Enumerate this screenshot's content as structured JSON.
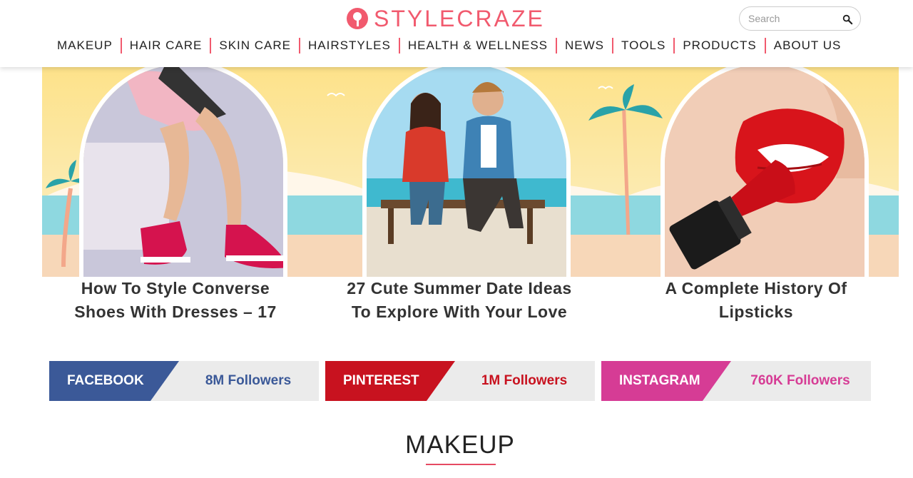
{
  "brand": {
    "name": "STYLECRAZE",
    "color": "#f15a6e"
  },
  "search": {
    "placeholder": "Search",
    "icon": "search-icon"
  },
  "nav": {
    "items": [
      {
        "label": "MAKEUP"
      },
      {
        "label": "HAIR CARE"
      },
      {
        "label": "SKIN CARE"
      },
      {
        "label": "HAIRSTYLES"
      },
      {
        "label": "HEALTH & WELLNESS"
      },
      {
        "label": "NEWS"
      },
      {
        "label": "TOOLS"
      },
      {
        "label": "PRODUCTS"
      },
      {
        "label": "ABOUT US"
      }
    ]
  },
  "hero": {
    "cards": [
      {
        "title_line1": "How To Style Converse",
        "title_line2": "Shoes With Dresses – 17"
      },
      {
        "title_line1": "27 Cute Summer Date Ideas",
        "title_line2": "To Explore With Your Love"
      },
      {
        "title_line1": "A Complete History Of",
        "title_line2": "Lipsticks"
      }
    ]
  },
  "social": [
    {
      "network": "FACEBOOK",
      "followers": "8M Followers",
      "color": "#3b5998"
    },
    {
      "network": "PINTEREST",
      "followers": "1M Followers",
      "color": "#c8121f"
    },
    {
      "network": "INSTAGRAM",
      "followers": "760K Followers",
      "color": "#d63c95"
    }
  ],
  "section": {
    "title": "MAKEUP",
    "underline_color": "#e64a62"
  }
}
